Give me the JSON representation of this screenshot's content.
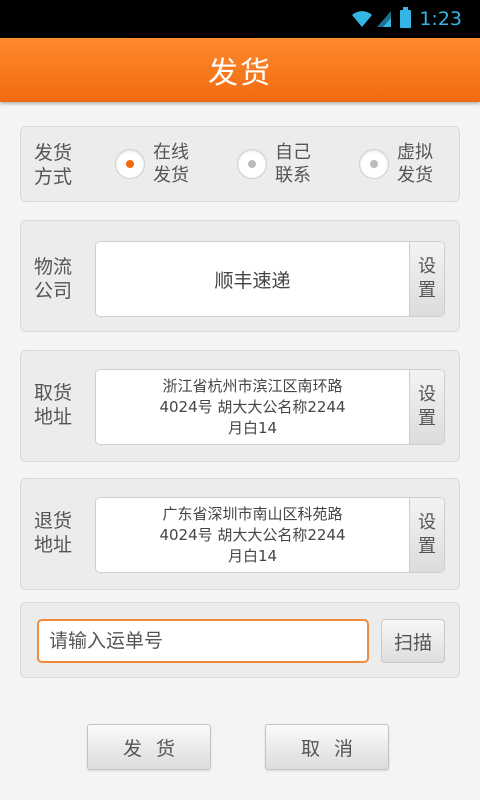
{
  "status_bar": {
    "time": "1:23",
    "accent": "#33b5e5"
  },
  "header": {
    "title": "发货",
    "color": "#f26a10"
  },
  "shipping_method": {
    "label": "发货\n方式",
    "options": [
      {
        "label": "在线\n发货",
        "checked": true
      },
      {
        "label": "自己\n联系",
        "checked": false
      },
      {
        "label": "虚拟\n发货",
        "checked": false
      }
    ]
  },
  "logistics": {
    "label": "物流\n公司",
    "value": "顺丰速递",
    "set_label": "设\n置"
  },
  "pickup": {
    "label": "取货\n地址",
    "value": "浙江省杭州市滨江区南环路\n4024号 胡大大公名称2244\n月白14",
    "set_label": "设\n置"
  },
  "return": {
    "label": "退货\n地址",
    "value": "广东省深圳市南山区科苑路\n4024号 胡大大公名称2244\n月白14",
    "set_label": "设\n置"
  },
  "tracking": {
    "placeholder": "请输入运单号",
    "scan_label": "扫描"
  },
  "actions": {
    "ship": "发货",
    "cancel": "取消"
  },
  "icons": [
    "wifi-icon",
    "signal-icon",
    "battery-icon",
    "radio-button-icon"
  ]
}
